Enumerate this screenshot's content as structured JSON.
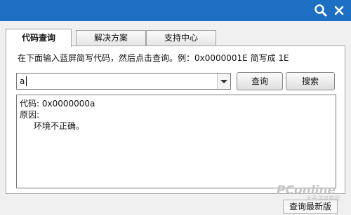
{
  "tabs": [
    {
      "label": "代码查询"
    },
    {
      "label": "解决方案"
    },
    {
      "label": "支持中心"
    }
  ],
  "query": {
    "instruction": "在下面输入蓝屏简写代码，然后点击查询。例：0x0000001E 简写成 1E",
    "input_value": "a",
    "query_button": "查询",
    "search_button": "搜索"
  },
  "result": {
    "code_line": "代码: 0x0000000a",
    "reason_label": "原因:",
    "reason_text": "环境不正确。"
  },
  "footer": {
    "update_button": "查询最新版"
  },
  "watermark": {
    "text": "PConline",
    "subtext": "太平洋电脑网"
  },
  "colors": {
    "titlebar": "#1d6fc4",
    "watermark": "#c5c5c5"
  },
  "icons": {
    "title_search": "magnifier-icon",
    "title_close": "close-icon",
    "dropdown": "chevron-down-icon"
  }
}
